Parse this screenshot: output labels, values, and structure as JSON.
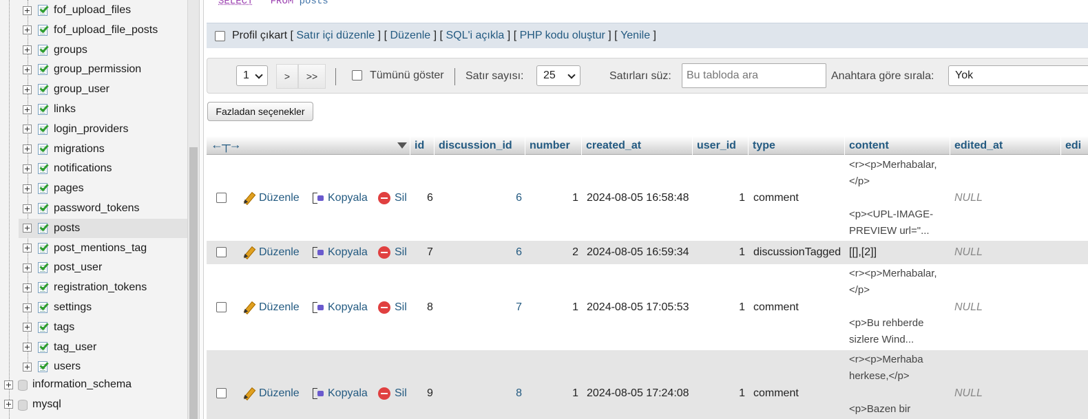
{
  "nav": {
    "tables": [
      {
        "label": "fof_upload_files"
      },
      {
        "label": "fof_upload_file_posts"
      },
      {
        "label": "groups"
      },
      {
        "label": "group_permission"
      },
      {
        "label": "group_user"
      },
      {
        "label": "links"
      },
      {
        "label": "login_providers"
      },
      {
        "label": "migrations"
      },
      {
        "label": "notifications"
      },
      {
        "label": "pages"
      },
      {
        "label": "password_tokens"
      },
      {
        "label": "posts",
        "selected": true
      },
      {
        "label": "post_mentions_tag"
      },
      {
        "label": "post_user"
      },
      {
        "label": "registration_tokens"
      },
      {
        "label": "settings"
      },
      {
        "label": "tags"
      },
      {
        "label": "tag_user"
      },
      {
        "label": "users"
      }
    ],
    "databases": [
      {
        "label": "information_schema"
      },
      {
        "label": "mysql"
      }
    ]
  },
  "sql": {
    "select": "SELECT",
    "star": "*",
    "from": "FROM",
    "table": "posts"
  },
  "sql_tools": {
    "profile": "Profil çıkart",
    "inline_edit": "Satır içi düzenle",
    "edit": "Düzenle",
    "explain": "SQL'i açıkla",
    "php": "PHP kodu oluştur",
    "refresh": "Yenile",
    "open_bracket": "[",
    "close_bracket": "]"
  },
  "navbar": {
    "page": "1",
    "next": ">",
    "last": ">>",
    "show_all": "Tümünü göster",
    "rows_label": "Satır sayısı:",
    "rows_value": "25",
    "filter_label": "Satırları süz:",
    "filter_placeholder": "Bu tabloda ara",
    "sort_label": "Anahtara göre sırala:",
    "sort_value": "Yok"
  },
  "more_options": "Fazladan seçenekler",
  "table": {
    "columns": [
      "id",
      "discussion_id",
      "number",
      "created_at",
      "user_id",
      "type",
      "content",
      "edited_at",
      "edi"
    ],
    "actions": {
      "edit": "Düzenle",
      "copy": "Kopyala",
      "delete": "Sil"
    },
    "rows": [
      {
        "id": "6",
        "discussion_id": "6",
        "number": "1",
        "created_at": "2024-08-05 16:58:48",
        "user_id": "1",
        "type": "comment",
        "content": [
          "<r><p>Merhabalar,",
          "</p>",
          "",
          "<p><UPL-IMAGE-",
          "PREVIEW url=\"..."
        ],
        "edited_at": "NULL"
      },
      {
        "id": "7",
        "discussion_id": "6",
        "number": "2",
        "created_at": "2024-08-05 16:59:34",
        "user_id": "1",
        "type": "discussionTagged",
        "content": [
          "[[],[2]]"
        ],
        "edited_at": "NULL"
      },
      {
        "id": "8",
        "discussion_id": "7",
        "number": "1",
        "created_at": "2024-08-05 17:05:53",
        "user_id": "1",
        "type": "comment",
        "content": [
          "<r><p>Merhabalar,",
          "</p>",
          "",
          "<p>Bu rehberde",
          "sizlere Wind..."
        ],
        "edited_at": "NULL"
      },
      {
        "id": "9",
        "discussion_id": "8",
        "number": "1",
        "created_at": "2024-08-05 17:24:08",
        "user_id": "1",
        "type": "comment",
        "content": [
          "<r><p>Merhaba",
          "herkese,</p>",
          "",
          "<p>Bazen bir"
        ],
        "edited_at": "NULL"
      }
    ]
  }
}
